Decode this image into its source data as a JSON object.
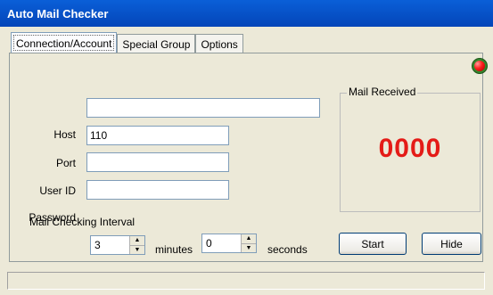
{
  "window": {
    "title": "Auto Mail Checker"
  },
  "tabs": [
    {
      "label": "Connection/Account"
    },
    {
      "label": "Special Group"
    },
    {
      "label": "Options"
    }
  ],
  "form": {
    "host": {
      "label": "Host",
      "value": ""
    },
    "port": {
      "label": "Port",
      "value": "110"
    },
    "user_id": {
      "label": "User ID",
      "value": ""
    },
    "password": {
      "label": "Password",
      "value": ""
    }
  },
  "interval": {
    "label": "Mail Checking Interval",
    "minutes_value": "3",
    "minutes_unit": "minutes",
    "seconds_value": "0",
    "seconds_unit": "seconds"
  },
  "mail_received": {
    "label": "Mail Received",
    "count": "0000",
    "color": "#e41b17"
  },
  "buttons": {
    "start": "Start",
    "hide": "Hide"
  },
  "status_indicator": {
    "icon": "red-led-icon",
    "color": "#ff2020"
  }
}
